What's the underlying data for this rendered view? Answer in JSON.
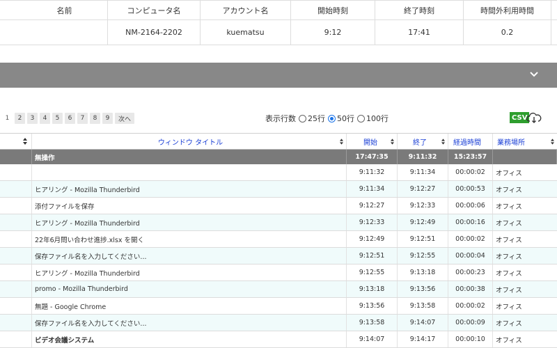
{
  "summary": {
    "headers": [
      "名前",
      "コンピュータ名",
      "アカウント名",
      "開始時刻",
      "終了時刻",
      "時間外利用時間"
    ],
    "row": [
      "",
      "NM-2164-2202",
      "kuematsu",
      "9:12",
      "17:41",
      "0.2"
    ]
  },
  "pager": {
    "current": "1",
    "pages": [
      "2",
      "3",
      "4",
      "5",
      "6",
      "7",
      "8",
      "9"
    ],
    "next_label": "次へ"
  },
  "rows_control": {
    "label": "表示行数",
    "options": [
      "25行",
      "50行",
      "100行"
    ],
    "selected": "50行"
  },
  "export": {
    "csv_label": "CSV",
    "icon": "cloud-download-icon"
  },
  "log": {
    "headers": [
      "",
      "ウィンドウ タイトル",
      "開始",
      "終了",
      "経過時間",
      "業務場所"
    ],
    "group": {
      "title": "無操作",
      "start": "17:47:35",
      "end": "9:11:32",
      "elapsed": "15:23:57",
      "place": ""
    },
    "rows": [
      {
        "title": "",
        "start": "9:11:32",
        "end": "9:11:34",
        "elapsed": "00:00:02",
        "place": "オフィス"
      },
      {
        "title": "ヒアリング - Mozilla Thunderbird",
        "start": "9:11:34",
        "end": "9:12:27",
        "elapsed": "00:00:53",
        "place": "オフィス"
      },
      {
        "title": "添付ファイルを保存",
        "start": "9:12:27",
        "end": "9:12:33",
        "elapsed": "00:00:06",
        "place": "オフィス"
      },
      {
        "title": "ヒアリング - Mozilla Thunderbird",
        "start": "9:12:33",
        "end": "9:12:49",
        "elapsed": "00:00:16",
        "place": "オフィス"
      },
      {
        "title": "22年6月問い合わせ進捗.xlsx を開く",
        "start": "9:12:49",
        "end": "9:12:51",
        "elapsed": "00:00:02",
        "place": "オフィス"
      },
      {
        "title": "保存ファイル名を入力してください...",
        "start": "9:12:51",
        "end": "9:12:55",
        "elapsed": "00:00:04",
        "place": "オフィス"
      },
      {
        "title": "ヒアリング - Mozilla Thunderbird",
        "start": "9:12:55",
        "end": "9:13:18",
        "elapsed": "00:00:23",
        "place": "オフィス"
      },
      {
        "title": "promo - Mozilla Thunderbird",
        "start": "9:13:18",
        "end": "9:13:56",
        "elapsed": "00:00:38",
        "place": "オフィス"
      },
      {
        "title": "無題 - Google Chrome",
        "start": "9:13:56",
        "end": "9:13:58",
        "elapsed": "00:00:02",
        "place": "オフィス"
      },
      {
        "title": "保存ファイル名を入力してください...",
        "start": "9:13:58",
        "end": "9:14:07",
        "elapsed": "00:00:09",
        "place": "オフィス"
      },
      {
        "title": "ビデオ会議システム",
        "start": "9:14:07",
        "end": "9:14:17",
        "elapsed": "00:00:10",
        "place": "オフィス"
      }
    ]
  },
  "colors": {
    "group_bar": "#888888",
    "alt_row": "#f0fbfb",
    "header_link": "#1a3fd6",
    "csv": "#2e9e2e"
  }
}
